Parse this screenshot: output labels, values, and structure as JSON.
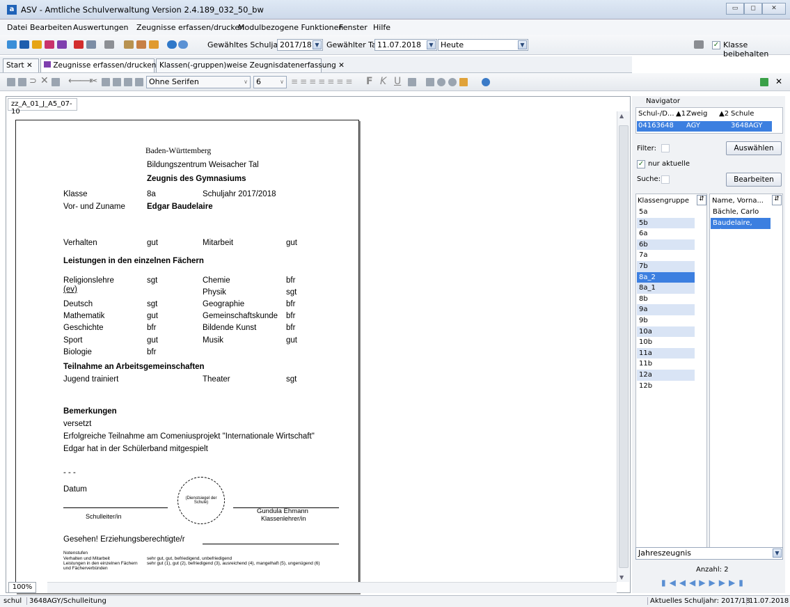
{
  "window": {
    "title": "ASV - Amtliche Schulverwaltung Version 2.4.189_032_50_bw",
    "app_icon": "a"
  },
  "menu": [
    "Datei",
    "Bearbeiten",
    "Auswertungen",
    "Zeugnisse erfassen/drucken",
    "Modulbezogene Funktionen",
    "Fenster",
    "Hilfe"
  ],
  "toolbar": {
    "schuljahr_label": "Gewähltes Schuljahr",
    "schuljahr_value": "2017/18",
    "tag_label": "Gewählter Tag",
    "tag_value": "11.07.2018",
    "heute_value": "Heute",
    "klasse_beibehalten": "Klasse beibehalten"
  },
  "tabs": [
    {
      "label": "Start"
    },
    {
      "label": "Zeugnisse erfassen/drucken"
    },
    {
      "label": "Klassen(-gruppen)weise Zeugnisdatenerfassung"
    }
  ],
  "format": {
    "font": "Ohne Serifen",
    "size": "6",
    "bold": "F",
    "italic": "K",
    "underline": "U"
  },
  "document": {
    "tab": "zz_A_01_J_A5_07-10",
    "state": "Baden-Württemberg",
    "school": "Bildungszentrum Weisacher Tal",
    "title": "Zeugnis des Gymnasiums",
    "klasse_label": "Klasse",
    "klasse": "8a",
    "schuljahr": "Schuljahr  2017/2018",
    "name_label": "Vor- und Zuname",
    "name": "Edgar Baudelaire",
    "verhalten_label": "Verhalten",
    "verhalten": "gut",
    "mitarbeit_label": "Mitarbeit",
    "mitarbeit": "gut",
    "leistungen_heading": "Leistungen in den einzelnen Fächern",
    "subjects_left": [
      {
        "name": "Religionslehre",
        "grade": "sgt"
      },
      {
        "name": "(ev)",
        "grade": ""
      },
      {
        "name": "Deutsch",
        "grade": "sgt"
      },
      {
        "name": "Mathematik",
        "grade": "gut"
      },
      {
        "name": "Geschichte",
        "grade": "bfr"
      },
      {
        "name": "Sport",
        "grade": "gut"
      },
      {
        "name": "Biologie",
        "grade": "bfr"
      }
    ],
    "subjects_right": [
      {
        "name": "Chemie",
        "grade": "bfr"
      },
      {
        "name": "Physik",
        "grade": "sgt"
      },
      {
        "name": "Geographie",
        "grade": "bfr"
      },
      {
        "name": "Gemeinschaftskunde",
        "grade": "bfr"
      },
      {
        "name": "Bildende Kunst",
        "grade": "bfr"
      },
      {
        "name": "Musik",
        "grade": "gut"
      }
    ],
    "ag_heading": "Teilnahme an Arbeitsgemeinschaften",
    "ag_name": "Jugend trainiert",
    "ag2_name": "Theater",
    "ag2_grade": "sgt",
    "bemerkungen_heading": "Bemerkungen",
    "remarks": [
      "versetzt",
      "Erfolgreiche Teilnahme am Comeniusprojekt \"Internationale Wirtschaft\"",
      "Edgar hat in der Schülerband mitgespielt"
    ],
    "dashes": "- - -",
    "datum": "Datum",
    "seal": "(Dienstsiegel der Schule)",
    "schulleiter": "Schulleiter/in",
    "teacher_name": "Gundula Ehmann",
    "teacher_role": "Klassenlehrer/in",
    "gesehen": "Gesehen! Erziehungsberechtigte/r",
    "notenstufen": "Notenstufen",
    "legend1_label": "Verhalten und Mitarbeit",
    "legend1": "sehr gut, gut, befriedigend, unbefriedigend",
    "legend2_label": "Leistungen in den einzelnen Fächern",
    "legend2": "sehr gut (1), gut (2), befriedigend (3), ausreichend (4), mangelhaft (5), ungenügend (6)",
    "legend3": "und Fächerverbünden",
    "zoom": "100%"
  },
  "navigator": {
    "title": "Navigator",
    "col1": "Schul-/D...",
    "col1_sort": "▲1",
    "col2": "Zweig",
    "col3_sort": "▲2",
    "col3": "Schule",
    "row": {
      "c1": "04163648",
      "c2": "AGY",
      "c3": "3648AGY"
    },
    "filter_label": "Filter:",
    "auswaehlen": "Auswählen",
    "nur_aktuelle": "nur aktuelle",
    "suche_label": "Suche:",
    "bearbeiten": "Bearbeiten",
    "kg_header": "Klassengruppe",
    "name_header": "Name, Vorna...",
    "klassengruppen": [
      "5a",
      "5b",
      "6a",
      "6b",
      "7a",
      "7b",
      "8a_2",
      "8a_1",
      "8b",
      "9a",
      "9b",
      "10a",
      "10b",
      "11a",
      "11b",
      "12a",
      "12b"
    ],
    "names": [
      "Bächle, Carlo",
      "Baudelaire, Edgar"
    ],
    "zeugnisart": "Jahreszeugnis",
    "anzahl": "Anzahl: 2"
  },
  "status": {
    "left1": "schul",
    "left2": "3648AGY/Schulleitung",
    "right1": "Aktuelles Schuljahr: 2017/18",
    "right2": "11.07.2018"
  }
}
